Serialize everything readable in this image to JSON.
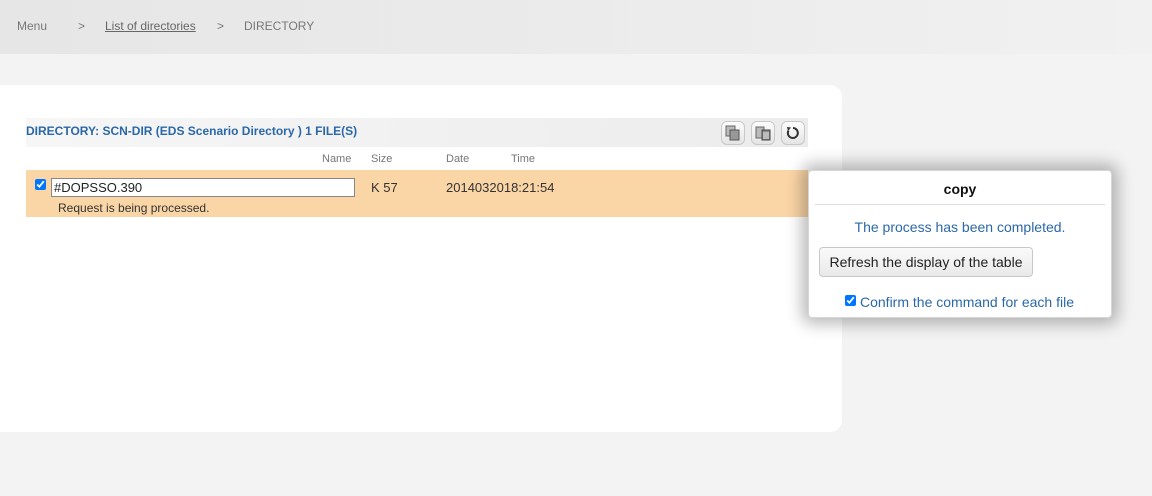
{
  "breadcrumb": {
    "menu": "Menu",
    "sep1": ">",
    "list": "List of directories",
    "sep2": ">",
    "current": "DIRECTORY"
  },
  "directory": {
    "title": "DIRECTORY: SCN-DIR (EDS Scenario Directory ) 1 FILE(S)",
    "toolbar": {
      "copy_icon": "copy-icon",
      "delete_icon": "delete-icon",
      "refresh_icon": "refresh-icon"
    },
    "columns": {
      "name": "Name",
      "size": "Size",
      "date": "Date",
      "time": "Time"
    },
    "rows": [
      {
        "checked": true,
        "name": "#DOPSSO.390",
        "size": "K 57",
        "datetime": "2014032018:21:54",
        "status": "Request is being processed."
      }
    ],
    "row_highlight_color": "#fad5a6"
  },
  "dialog": {
    "title": "copy",
    "message": "The process has been completed.",
    "refresh_button": "Refresh the display of the table",
    "confirm_label": "Confirm the command for each file",
    "confirm_checked": true
  },
  "colors": {
    "accent": "#2a68a8"
  }
}
